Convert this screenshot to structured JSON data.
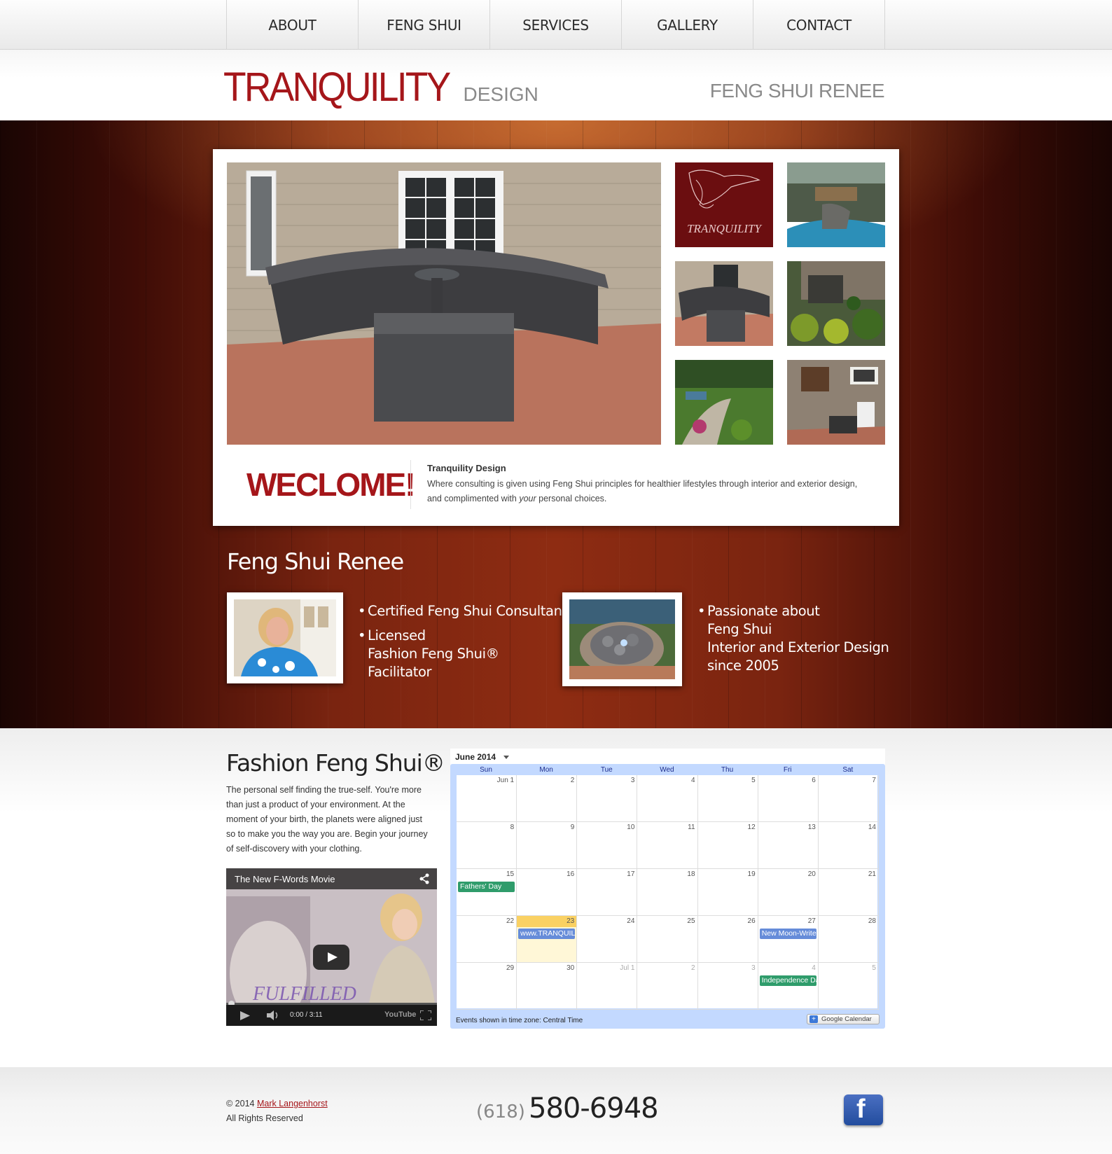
{
  "nav": {
    "items": [
      {
        "label": "ABOUT"
      },
      {
        "label": "FENG SHUI"
      },
      {
        "label": "SERVICES"
      },
      {
        "label": "GALLERY"
      },
      {
        "label": "CONTACT"
      }
    ]
  },
  "header": {
    "brand_main": "TRANQUILITY",
    "brand_sub": "DESIGN",
    "right_title": "FENG SHUI RENEE"
  },
  "showcase": {
    "logo_thumb_text": "TRANQUILITY",
    "welcome": "WECLOME!",
    "title": "Tranquility Design",
    "text_before": "Where consulting is given using Feng Shui principles for healthier lifestyles through interior and exterior design, and complimented with ",
    "text_em": "your",
    "text_after": " personal choices."
  },
  "renee": {
    "title": "Feng Shui Renee",
    "left_bullets": [
      [
        "Certified Feng Shui Consultant"
      ],
      [
        "Licensed",
        "Fashion Feng Shui®",
        "Facilitator"
      ]
    ],
    "right_bullets": [
      [
        "Passionate about",
        "Feng Shui",
        "Interior and Exterior Design",
        "since 2005"
      ]
    ]
  },
  "fashion": {
    "title": "Fashion Feng Shui®",
    "text": "The personal self finding the true-self. You're more than just a product of your environment. At the moment of your birth, the planets were aligned just so to make you the way you are. Begin your journey of self-discovery with your clothing."
  },
  "video": {
    "title": "The New F-Words Movie",
    "overlay_text": "FULFILLED",
    "time": "0:00 / 3:11",
    "brand": "YouTube"
  },
  "calendar": {
    "month_label": "June 2014",
    "days": [
      "Sun",
      "Mon",
      "Tue",
      "Wed",
      "Thu",
      "Fri",
      "Sat"
    ],
    "weeks": [
      [
        "Jun 1",
        "2",
        "3",
        "4",
        "5",
        "6",
        "7"
      ],
      [
        "8",
        "9",
        "10",
        "11",
        "12",
        "13",
        "14"
      ],
      [
        "15",
        "16",
        "17",
        "18",
        "19",
        "20",
        "21"
      ],
      [
        "22",
        "23",
        "24",
        "25",
        "26",
        "27",
        "28"
      ],
      [
        "29",
        "30",
        "Jul 1",
        "2",
        "3",
        "4",
        "5"
      ]
    ],
    "events": [
      {
        "week": 2,
        "day": 0,
        "label": "Fathers' Day",
        "color": "#2f9c6b"
      },
      {
        "week": 3,
        "day": 1,
        "label": "www.TRANQUILITY",
        "color": "#668cd9"
      },
      {
        "week": 3,
        "day": 5,
        "label": "New Moon-Write",
        "color": "#668cd9"
      },
      {
        "week": 4,
        "day": 5,
        "label": "Independence Day",
        "color": "#2f9c6b"
      }
    ],
    "today": {
      "week": 3,
      "day": 1
    },
    "footer_text": "Events shown in time zone: Central Time",
    "gcal_label": "Google Calendar"
  },
  "footer": {
    "copyright": "© 2014 ",
    "author": "Mark Langenhorst",
    "rights": "All Rights Reserved",
    "phone_area": "(618)",
    "phone_number": "580-6948"
  },
  "colors": {
    "brand_red": "#a5161a",
    "gray_text": "#8a8a8a",
    "calendar_frame": "#c3d9ff"
  }
}
